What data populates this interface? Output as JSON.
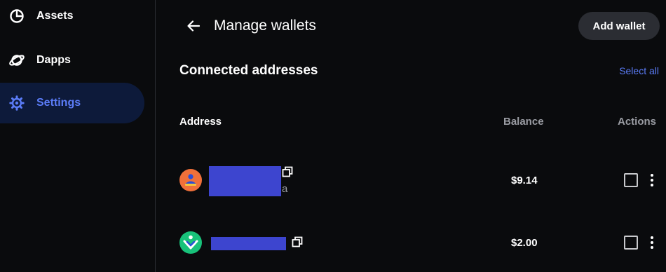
{
  "sidebar": {
    "items": [
      {
        "label": "Assets",
        "icon": "pie-chart-icon"
      },
      {
        "label": "Dapps",
        "icon": "planet-icon"
      },
      {
        "label": "Settings",
        "icon": "gear-icon",
        "active": true
      }
    ]
  },
  "header": {
    "title": "Manage wallets",
    "add_wallet_label": "Add wallet"
  },
  "section": {
    "title": "Connected addresses",
    "select_all_label": "Select all"
  },
  "table": {
    "columns": {
      "address": "Address",
      "balance": "Balance",
      "actions": "Actions"
    },
    "rows": [
      {
        "address_suffix": "a",
        "balance": "$9.14",
        "avatar_color": "#f0703a"
      },
      {
        "address_suffix": "",
        "balance": "$2.00",
        "avatar_color": "#18c27a"
      }
    ]
  },
  "colors": {
    "accent": "#5b7cf7",
    "background": "#0a0b0d",
    "redaction": "#3d45cf"
  }
}
